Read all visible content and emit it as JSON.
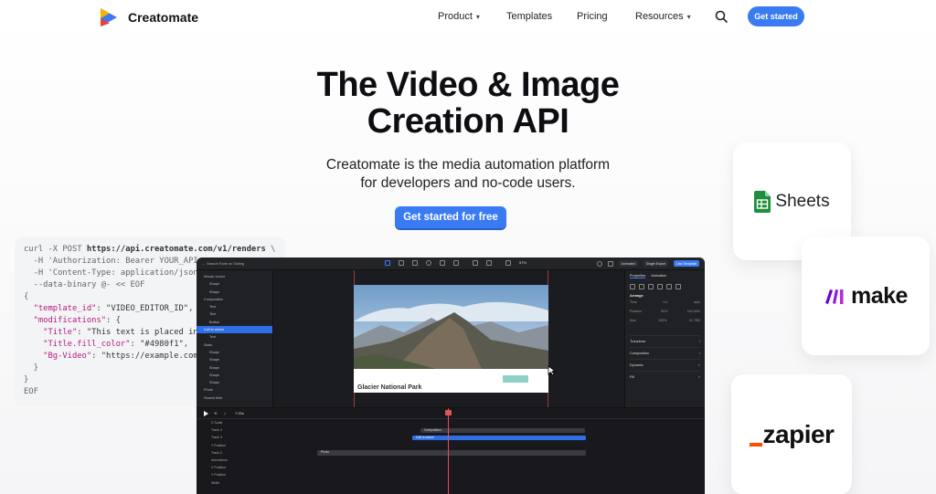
{
  "nav": {
    "brand": "Creatomate",
    "items": [
      {
        "label": "Product",
        "has_dropdown": true
      },
      {
        "label": "Templates",
        "has_dropdown": false
      },
      {
        "label": "Pricing",
        "has_dropdown": false
      },
      {
        "label": "Resources",
        "has_dropdown": true
      }
    ],
    "cta_label": "Get started"
  },
  "hero": {
    "title_line1": "The Video & Image",
    "title_line2": "Creation API",
    "subtitle_line1": "Creatomate is the media automation platform",
    "subtitle_line2": "for developers and no-code users.",
    "cta_label": "Get started for free"
  },
  "code": {
    "lines": [
      [
        "curl -X POST ",
        "https://api.creatomate.com/v1/renders",
        " \\"
      ],
      [
        "  -H 'Authorization: Bearer YOUR_API"
      ],
      [
        "  -H 'Content-Type: application/json"
      ],
      [
        "  --data-binary @- << EOF"
      ],
      [
        "{"
      ],
      [
        "  \"template_id\"",
        ": ",
        "\"VIDEO_EDITOR_ID\"",
        ","
      ],
      [
        "  \"modifications\"",
        ": {"
      ],
      [
        "    \"Title\"",
        ": ",
        "\"This text is placed in"
      ],
      [
        "    \"Title.fill_color\"",
        ": ",
        "\"#4980f1\"",
        ","
      ],
      [
        "    \"Bg-Video\"",
        ": ",
        "\"https://example.com"
      ],
      [
        "  }"
      ],
      [
        "}"
      ],
      [
        "EOF"
      ]
    ]
  },
  "integrations": {
    "sheets": "Sheets",
    "make": "make",
    "zapier": "zapier"
  },
  "editor": {
    "search": "Search Fade w/ Sliding",
    "zoom": "57%",
    "chip_animated": "Animated",
    "chip_export": "Single Export",
    "chip_template": "Use Template",
    "layers": [
      {
        "label": "Mouse cursor",
        "indent": false,
        "selected": false
      },
      {
        "label": "Shape",
        "indent": true,
        "selected": false
      },
      {
        "label": "Shape",
        "indent": true,
        "selected": false
      },
      {
        "label": "Composition",
        "indent": false,
        "selected": false
      },
      {
        "label": "Text",
        "indent": true,
        "selected": false
      },
      {
        "label": "Text",
        "indent": true,
        "selected": false
      },
      {
        "label": "Button",
        "indent": true,
        "selected": false
      },
      {
        "label": "Call to action",
        "indent": false,
        "selected": true
      },
      {
        "label": "Text",
        "indent": true,
        "selected": false
      },
      {
        "label": "Stars",
        "indent": false,
        "selected": false
      },
      {
        "label": "Shape",
        "indent": true,
        "selected": false
      },
      {
        "label": "Shape",
        "indent": true,
        "selected": false
      },
      {
        "label": "Shape",
        "indent": true,
        "selected": false
      },
      {
        "label": "Shape",
        "indent": true,
        "selected": false
      },
      {
        "label": "Shape",
        "indent": true,
        "selected": false
      },
      {
        "label": "Photo",
        "indent": false,
        "selected": false
      },
      {
        "label": "Search field",
        "indent": false,
        "selected": false
      }
    ],
    "canvas_title": "Glacier National Park",
    "props": {
      "tab1": "Properties",
      "tab2": "Animation",
      "arrange_title": "Arrange",
      "rows": [
        {
          "label": "Time",
          "a": "0 s",
          "b": "auto"
        },
        {
          "label": "Position",
          "a": "50%",
          "b": "102.84%"
        },
        {
          "label": "Size",
          "a": "100%",
          "b": "21.78%"
        }
      ],
      "sections": [
        "Transform",
        "Composition",
        "Dynamic",
        "Fill"
      ]
    },
    "timeline": {
      "time": "7.00s",
      "tracks": [
        {
          "label": "X Scale",
          "clip": null
        },
        {
          "label": "Track 4",
          "clip": {
            "label": "Composition",
            "color": "#3a3b40"
          }
        },
        {
          "label": "Track 3",
          "clip": {
            "label": "Call to action",
            "color": "#2f6fe6"
          }
        },
        {
          "label": "Y Position",
          "clip": null
        },
        {
          "label": "Track 2",
          "clip": {
            "label": "Photo",
            "color": "#3a3b40"
          }
        },
        {
          "label": "Animations",
          "clip": null
        },
        {
          "label": "X Position",
          "clip": null
        },
        {
          "label": "Y Position",
          "clip": null
        },
        {
          "label": "Width",
          "clip": null
        }
      ]
    }
  },
  "colors": {
    "accent": "#3a7bf2",
    "sheets_green": "#1e8e3e",
    "make_purple": "#6d00cc",
    "zapier_orange": "#ff4a00"
  }
}
